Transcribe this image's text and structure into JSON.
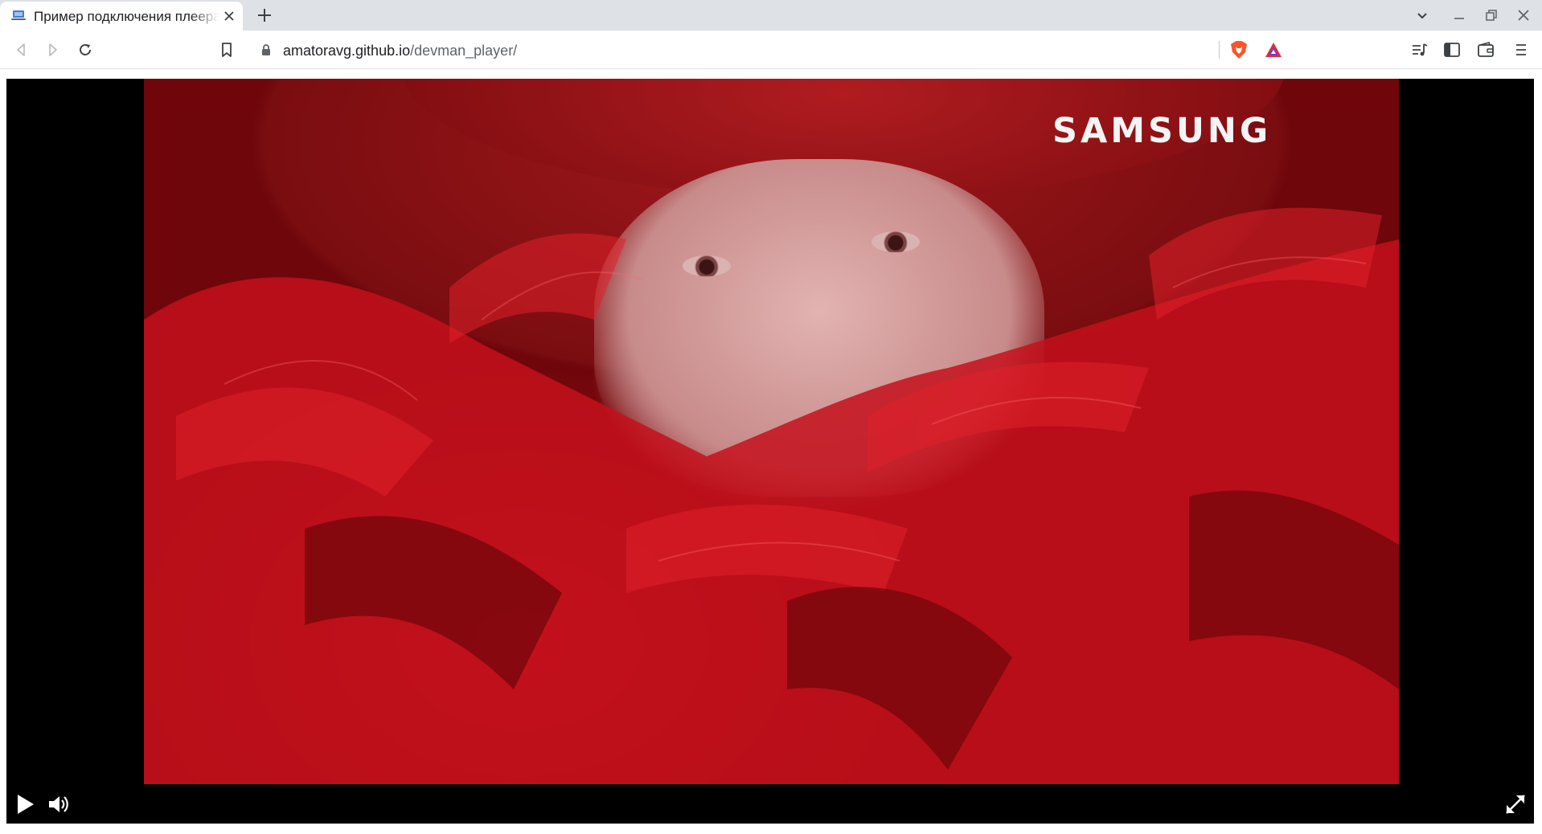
{
  "browser": {
    "tab": {
      "title": "Пример подключения плеера",
      "favicon": "laptop-favicon-icon"
    },
    "toolbar": {
      "url_host": "amatoravg.github.io",
      "url_path": "/devman_player/",
      "icons": [
        "back-icon",
        "forward-icon",
        "reload-icon",
        "bookmark-icon",
        "lock-icon",
        "brave-shields-icon",
        "brave-rewards-icon",
        "playlist-icon",
        "sidebar-icon",
        "wallet-icon",
        "menu-icon"
      ]
    },
    "window_controls": [
      "tab-search-icon",
      "minimize-icon",
      "restore-icon",
      "close-icon"
    ]
  },
  "player": {
    "watermark": "SAMSUNG",
    "state": "paused",
    "controls": [
      "play-icon",
      "volume-icon",
      "fullscreen-icon"
    ]
  },
  "colors": {
    "brave_orange": "#fb542b",
    "rewards_red": "#e52b3a",
    "rewards_purple": "#6b3ec9",
    "video_red": "#a01219"
  }
}
